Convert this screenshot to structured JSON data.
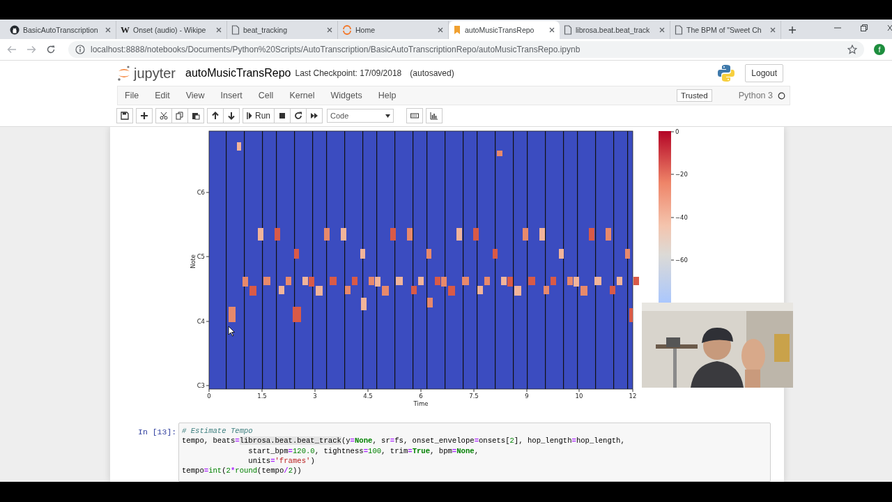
{
  "browser": {
    "tabs": [
      {
        "title": "BasicAutoTranscription",
        "kind": "github",
        "selected": false
      },
      {
        "title": "Onset (audio) - Wikipe",
        "kind": "letter",
        "icon_text": "W",
        "selected": false
      },
      {
        "title": "beat_tracking",
        "kind": "doc",
        "selected": false
      },
      {
        "title": "Home",
        "kind": "ring",
        "selected": false
      },
      {
        "title": "autoMusicTransRepo",
        "kind": "bookmark",
        "selected": true
      },
      {
        "title": "librosa.beat.beat_track",
        "kind": "doc",
        "selected": false
      },
      {
        "title": "The BPM of \"Sweet Ch",
        "kind": "doc",
        "selected": false
      }
    ],
    "url": "localhost:8888/notebooks/Documents/Python%20Scripts/AutoTranscription/BasicAutoTranscriptionRepo/autoMusicTransRepo.ipynb",
    "profile_initial": "f"
  },
  "notebook": {
    "logo_text": "jupyter",
    "name": "autoMusicTransRepo",
    "checkpoint": "Last Checkpoint: 17/09/2018",
    "autosave": "(autosaved)",
    "logout": "Logout",
    "menu": [
      "File",
      "Edit",
      "View",
      "Insert",
      "Cell",
      "Kernel",
      "Widgets",
      "Help"
    ],
    "trusted": "Trusted",
    "kernel": "Python 3",
    "toolbar": {
      "run": "Run",
      "cell_type": "Code"
    }
  },
  "plot": {
    "ylabel": "Note",
    "yticks": [
      "C6",
      "C5",
      "C4",
      "C3"
    ],
    "xlabel": "Time",
    "xticks": [
      "0",
      "1.5",
      "3",
      "4.5",
      "6",
      "7.5",
      "9",
      "10",
      "12"
    ],
    "colorbar_ticks": [
      "0",
      "−20",
      "−40",
      "−60"
    ]
  },
  "cell": {
    "prompt": "In [13]:",
    "lines": [
      [
        {
          "text": "# Estimate Tempo",
          "kind": "comment"
        }
      ],
      [
        {
          "text": "tempo, beats",
          "kind": "plain"
        },
        {
          "text": "=",
          "kind": "op"
        },
        {
          "text": "librosa.beat.beat_track",
          "kind": "match"
        },
        {
          "text": "(y",
          "kind": "plain"
        },
        {
          "text": "=",
          "kind": "op"
        },
        {
          "text": "None",
          "kind": "kw"
        },
        {
          "text": ", sr",
          "kind": "plain"
        },
        {
          "text": "=",
          "kind": "op"
        },
        {
          "text": "fs, onset_envelope",
          "kind": "plain"
        },
        {
          "text": "=",
          "kind": "op"
        },
        {
          "text": "onsets[",
          "kind": "plain"
        },
        {
          "text": "2",
          "kind": "num"
        },
        {
          "text": "], hop_length",
          "kind": "plain"
        },
        {
          "text": "=",
          "kind": "op"
        },
        {
          "text": "hop_length,",
          "kind": "plain"
        }
      ],
      [
        {
          "text": "               start_bpm",
          "kind": "plain"
        },
        {
          "text": "=",
          "kind": "op"
        },
        {
          "text": "120.0",
          "kind": "num"
        },
        {
          "text": ", tightness",
          "kind": "plain"
        },
        {
          "text": "=",
          "kind": "op"
        },
        {
          "text": "100",
          "kind": "num"
        },
        {
          "text": ", trim",
          "kind": "plain"
        },
        {
          "text": "=",
          "kind": "op"
        },
        {
          "text": "True",
          "kind": "kw"
        },
        {
          "text": ", bpm",
          "kind": "plain"
        },
        {
          "text": "=",
          "kind": "op"
        },
        {
          "text": "None",
          "kind": "kw"
        },
        {
          "text": ",",
          "kind": "plain"
        }
      ],
      [
        {
          "text": "               units",
          "kind": "plain"
        },
        {
          "text": "=",
          "kind": "op"
        },
        {
          "text": "'frames'",
          "kind": "str"
        },
        {
          "text": ")",
          "kind": "plain"
        }
      ],
      [
        {
          "text": "tempo",
          "kind": "plain"
        },
        {
          "text": "=",
          "kind": "op"
        },
        {
          "text": "int",
          "kind": "builtin"
        },
        {
          "text": "(",
          "kind": "plain"
        },
        {
          "text": "2",
          "kind": "num"
        },
        {
          "text": "*",
          "kind": "op"
        },
        {
          "text": "round",
          "kind": "builtin"
        },
        {
          "text": "(tempo",
          "kind": "plain"
        },
        {
          "text": "/",
          "kind": "op"
        },
        {
          "text": "2",
          "kind": "num"
        },
        {
          "text": "))",
          "kind": "plain"
        }
      ]
    ]
  }
}
